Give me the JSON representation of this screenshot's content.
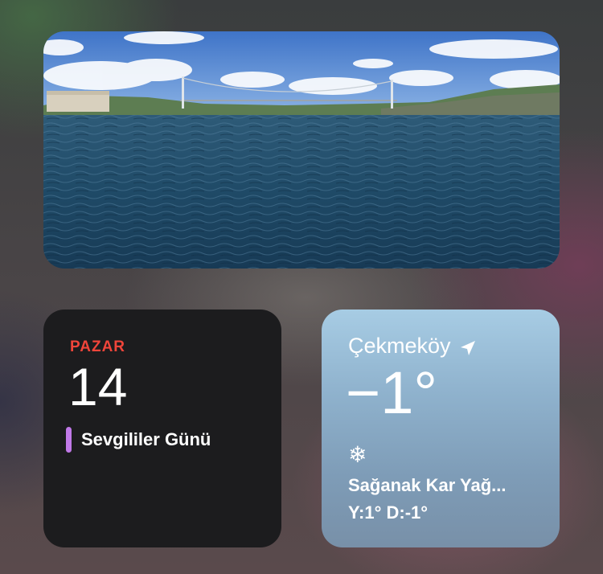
{
  "photo_widget": {
    "icon": "landscape-photo"
  },
  "calendar": {
    "day_label": "PAZAR",
    "date": "14",
    "event_label": "Sevgililer Günü",
    "event_color": "#c079e8",
    "day_color": "#f0453a"
  },
  "weather": {
    "city": "Çekmeköy",
    "temperature": "−1°",
    "condition_icon": "snowflake-icon",
    "condition_glyph": "❄",
    "condition": "Sağanak Kar Yağ...",
    "high_low": "Y:1° D:-1°"
  }
}
